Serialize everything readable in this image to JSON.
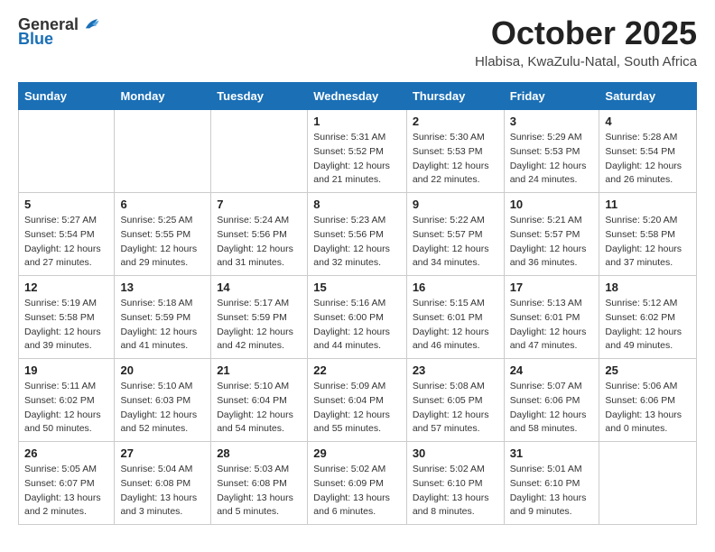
{
  "logo": {
    "general": "General",
    "blue": "Blue"
  },
  "title": "October 2025",
  "subtitle": "Hlabisa, KwaZulu-Natal, South Africa",
  "days_of_week": [
    "Sunday",
    "Monday",
    "Tuesday",
    "Wednesday",
    "Thursday",
    "Friday",
    "Saturday"
  ],
  "weeks": [
    [
      {
        "day": "",
        "info": ""
      },
      {
        "day": "",
        "info": ""
      },
      {
        "day": "",
        "info": ""
      },
      {
        "day": "1",
        "info": "Sunrise: 5:31 AM\nSunset: 5:52 PM\nDaylight: 12 hours\nand 21 minutes."
      },
      {
        "day": "2",
        "info": "Sunrise: 5:30 AM\nSunset: 5:53 PM\nDaylight: 12 hours\nand 22 minutes."
      },
      {
        "day": "3",
        "info": "Sunrise: 5:29 AM\nSunset: 5:53 PM\nDaylight: 12 hours\nand 24 minutes."
      },
      {
        "day": "4",
        "info": "Sunrise: 5:28 AM\nSunset: 5:54 PM\nDaylight: 12 hours\nand 26 minutes."
      }
    ],
    [
      {
        "day": "5",
        "info": "Sunrise: 5:27 AM\nSunset: 5:54 PM\nDaylight: 12 hours\nand 27 minutes."
      },
      {
        "day": "6",
        "info": "Sunrise: 5:25 AM\nSunset: 5:55 PM\nDaylight: 12 hours\nand 29 minutes."
      },
      {
        "day": "7",
        "info": "Sunrise: 5:24 AM\nSunset: 5:56 PM\nDaylight: 12 hours\nand 31 minutes."
      },
      {
        "day": "8",
        "info": "Sunrise: 5:23 AM\nSunset: 5:56 PM\nDaylight: 12 hours\nand 32 minutes."
      },
      {
        "day": "9",
        "info": "Sunrise: 5:22 AM\nSunset: 5:57 PM\nDaylight: 12 hours\nand 34 minutes."
      },
      {
        "day": "10",
        "info": "Sunrise: 5:21 AM\nSunset: 5:57 PM\nDaylight: 12 hours\nand 36 minutes."
      },
      {
        "day": "11",
        "info": "Sunrise: 5:20 AM\nSunset: 5:58 PM\nDaylight: 12 hours\nand 37 minutes."
      }
    ],
    [
      {
        "day": "12",
        "info": "Sunrise: 5:19 AM\nSunset: 5:58 PM\nDaylight: 12 hours\nand 39 minutes."
      },
      {
        "day": "13",
        "info": "Sunrise: 5:18 AM\nSunset: 5:59 PM\nDaylight: 12 hours\nand 41 minutes."
      },
      {
        "day": "14",
        "info": "Sunrise: 5:17 AM\nSunset: 5:59 PM\nDaylight: 12 hours\nand 42 minutes."
      },
      {
        "day": "15",
        "info": "Sunrise: 5:16 AM\nSunset: 6:00 PM\nDaylight: 12 hours\nand 44 minutes."
      },
      {
        "day": "16",
        "info": "Sunrise: 5:15 AM\nSunset: 6:01 PM\nDaylight: 12 hours\nand 46 minutes."
      },
      {
        "day": "17",
        "info": "Sunrise: 5:13 AM\nSunset: 6:01 PM\nDaylight: 12 hours\nand 47 minutes."
      },
      {
        "day": "18",
        "info": "Sunrise: 5:12 AM\nSunset: 6:02 PM\nDaylight: 12 hours\nand 49 minutes."
      }
    ],
    [
      {
        "day": "19",
        "info": "Sunrise: 5:11 AM\nSunset: 6:02 PM\nDaylight: 12 hours\nand 50 minutes."
      },
      {
        "day": "20",
        "info": "Sunrise: 5:10 AM\nSunset: 6:03 PM\nDaylight: 12 hours\nand 52 minutes."
      },
      {
        "day": "21",
        "info": "Sunrise: 5:10 AM\nSunset: 6:04 PM\nDaylight: 12 hours\nand 54 minutes."
      },
      {
        "day": "22",
        "info": "Sunrise: 5:09 AM\nSunset: 6:04 PM\nDaylight: 12 hours\nand 55 minutes."
      },
      {
        "day": "23",
        "info": "Sunrise: 5:08 AM\nSunset: 6:05 PM\nDaylight: 12 hours\nand 57 minutes."
      },
      {
        "day": "24",
        "info": "Sunrise: 5:07 AM\nSunset: 6:06 PM\nDaylight: 12 hours\nand 58 minutes."
      },
      {
        "day": "25",
        "info": "Sunrise: 5:06 AM\nSunset: 6:06 PM\nDaylight: 13 hours\nand 0 minutes."
      }
    ],
    [
      {
        "day": "26",
        "info": "Sunrise: 5:05 AM\nSunset: 6:07 PM\nDaylight: 13 hours\nand 2 minutes."
      },
      {
        "day": "27",
        "info": "Sunrise: 5:04 AM\nSunset: 6:08 PM\nDaylight: 13 hours\nand 3 minutes."
      },
      {
        "day": "28",
        "info": "Sunrise: 5:03 AM\nSunset: 6:08 PM\nDaylight: 13 hours\nand 5 minutes."
      },
      {
        "day": "29",
        "info": "Sunrise: 5:02 AM\nSunset: 6:09 PM\nDaylight: 13 hours\nand 6 minutes."
      },
      {
        "day": "30",
        "info": "Sunrise: 5:02 AM\nSunset: 6:10 PM\nDaylight: 13 hours\nand 8 minutes."
      },
      {
        "day": "31",
        "info": "Sunrise: 5:01 AM\nSunset: 6:10 PM\nDaylight: 13 hours\nand 9 minutes."
      },
      {
        "day": "",
        "info": ""
      }
    ]
  ]
}
